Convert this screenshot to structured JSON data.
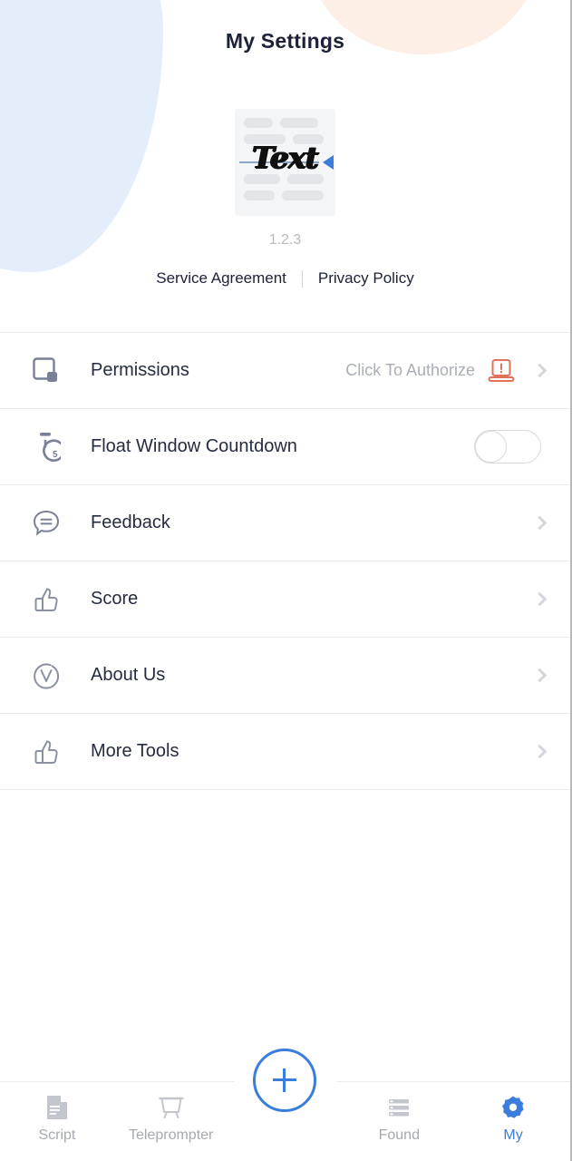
{
  "header": {
    "title": "My Settings"
  },
  "colors": {
    "accent": "#3b7ddd",
    "text_primary": "#262c40",
    "text_muted": "#aaaeb6",
    "warning": "#e2705a",
    "blob_blue": "#e4eefa",
    "blob_peach": "#fdeee6"
  },
  "logo": {
    "word": "Text",
    "icon_name": "text-document-logo",
    "pointer_icon": "blue-triangle-pointer-icon"
  },
  "app": {
    "version": "1.2.3"
  },
  "legal": {
    "service_agreement": "Service Agreement",
    "privacy_policy": "Privacy Policy"
  },
  "settings_rows": [
    {
      "label": "Permissions",
      "icon": "permission-square-icon",
      "value": "Click To Authorize",
      "badge_icon": "laptop-warning-icon",
      "control": "chevron"
    },
    {
      "label": "Float Window Countdown",
      "icon": "stopwatch-5-icon",
      "value": "",
      "control": "toggle",
      "toggle_on": false
    },
    {
      "label": "Feedback",
      "icon": "speech-bubble-icon",
      "value": "",
      "control": "chevron"
    },
    {
      "label": "Score",
      "icon": "thumbs-up-icon",
      "value": "",
      "control": "chevron"
    },
    {
      "label": "About Us",
      "icon": "circle-v-icon",
      "value": "",
      "control": "chevron"
    },
    {
      "label": "More Tools",
      "icon": "thumbs-up-icon",
      "value": "",
      "control": "chevron"
    }
  ],
  "bottom_nav": {
    "items": [
      {
        "label": "Script",
        "icon": "script-document-icon",
        "active": false
      },
      {
        "label": "Teleprompter",
        "icon": "teleprompter-icon",
        "active": false
      },
      {
        "label": "Found",
        "icon": "list-lines-icon",
        "active": false
      },
      {
        "label": "My",
        "icon": "gear-icon",
        "active": true
      }
    ],
    "fab": {
      "icon": "plus-icon",
      "label": ""
    }
  }
}
